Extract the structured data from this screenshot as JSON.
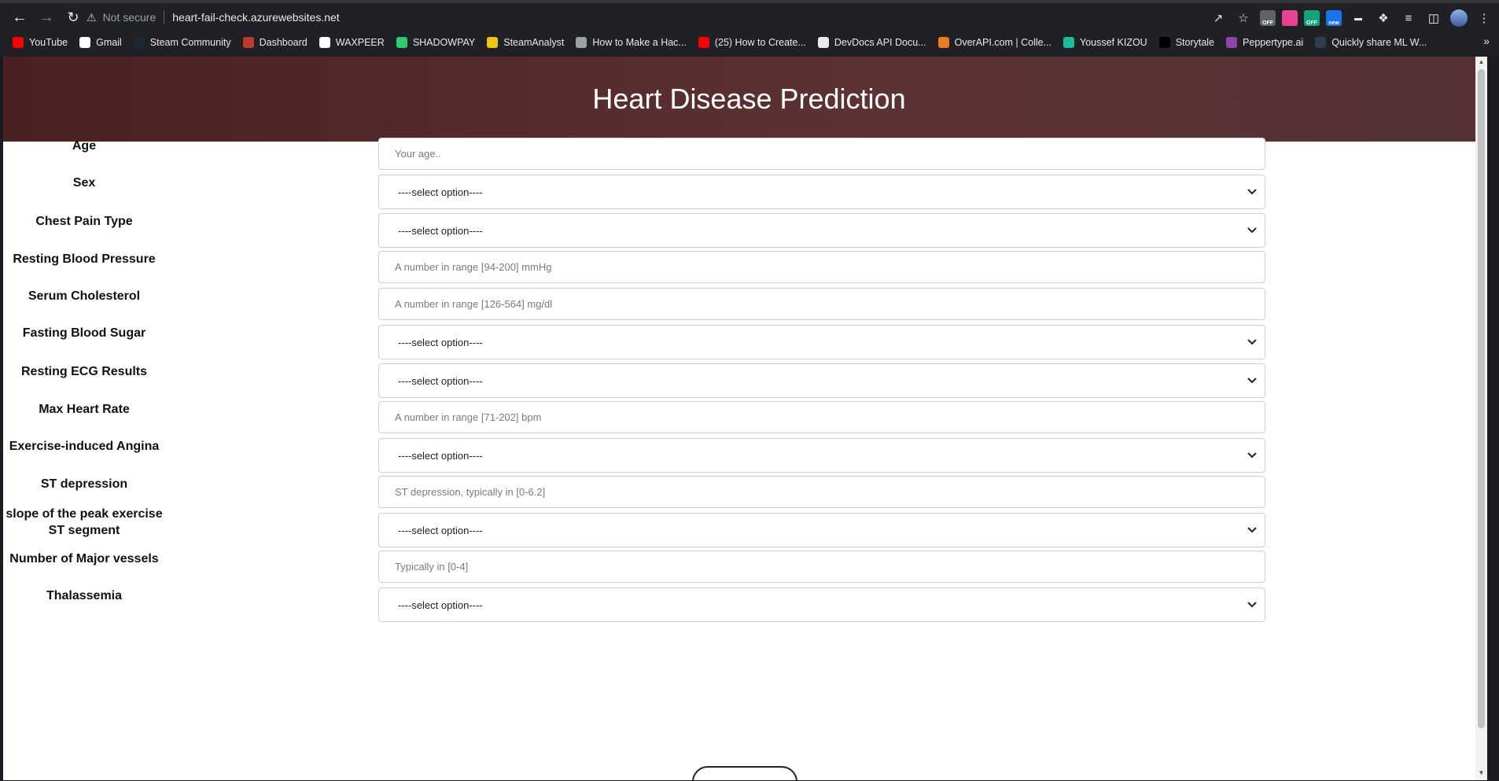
{
  "browser": {
    "not_secure": "Not secure",
    "url": "heart-fail-check.azurewebsites.net",
    "bookmarks": [
      {
        "label": "YouTube",
        "color": "#ff0000",
        "icon": "youtube-icon"
      },
      {
        "label": "Gmail",
        "color": "#ffffff",
        "icon": "google-icon"
      },
      {
        "label": "Steam Community",
        "color": "#1b2838",
        "icon": "steam-icon"
      },
      {
        "label": "Dashboard",
        "color": "#c0392b",
        "icon": "dashboard-icon"
      },
      {
        "label": "WAXPEER",
        "color": "#ffffff",
        "icon": "waxpeer-icon"
      },
      {
        "label": "SHADOWPAY",
        "color": "#2ecc71",
        "icon": "shadowpay-icon"
      },
      {
        "label": "SteamAnalyst",
        "color": "#f1c40f",
        "icon": "steamanalyst-icon"
      },
      {
        "label": "How to Make a Hac...",
        "color": "#9aa0a6",
        "icon": "globe-icon"
      },
      {
        "label": "(25) How to Create...",
        "color": "#ff0000",
        "icon": "youtube-icon"
      },
      {
        "label": "DevDocs API Docu...",
        "color": "#e8eaed",
        "icon": "devdocs-icon"
      },
      {
        "label": "OverAPI.com | Colle...",
        "color": "#e67e22",
        "icon": "overapi-icon"
      },
      {
        "label": "Youssef KIZOU",
        "color": "#1abc9c",
        "icon": "yk-icon"
      },
      {
        "label": "Storytale",
        "color": "#000000",
        "icon": "storytale-icon"
      },
      {
        "label": "Peppertype.ai",
        "color": "#8e44ad",
        "icon": "peppertype-icon"
      },
      {
        "label": "Quickly share ML W...",
        "color": "#2c3e50",
        "icon": "share-icon"
      }
    ],
    "extensions": [
      {
        "name": "off-extension-icon",
        "text": "OFF",
        "color": "#5f6368"
      },
      {
        "name": "color-extension-icon",
        "text": "",
        "color": "#e84393"
      },
      {
        "name": "grammarly-extension-icon",
        "text": "OFF",
        "color": "#15a37f"
      },
      {
        "name": "new-extension-icon",
        "text": "new",
        "color": "#1a73e8"
      }
    ]
  },
  "page": {
    "title": "Heart Disease Prediction",
    "submit_label": "",
    "fields": [
      {
        "label": "Age",
        "type": "input",
        "placeholder": "Your age.."
      },
      {
        "label": "Sex",
        "type": "select",
        "value": "----select option----"
      },
      {
        "label": "Chest Pain Type",
        "type": "select",
        "value": "----select option----"
      },
      {
        "label": "Resting Blood Pressure",
        "type": "input",
        "placeholder": "A number in range [94-200] mmHg"
      },
      {
        "label": "Serum Cholesterol",
        "type": "input",
        "placeholder": "A number in range [126-564] mg/dl"
      },
      {
        "label": "Fasting Blood Sugar",
        "type": "select",
        "value": "----select option----"
      },
      {
        "label": "Resting ECG Results",
        "type": "select",
        "value": "----select option----"
      },
      {
        "label": "Max Heart Rate",
        "type": "input",
        "placeholder": "A number in range [71-202] bpm"
      },
      {
        "label": "Exercise-induced Angina",
        "type": "select",
        "value": "----select option----"
      },
      {
        "label": "ST depression",
        "type": "input",
        "placeholder": "ST depression, typically in [0-6.2]"
      },
      {
        "label": "slope of the peak exercise ST segment",
        "type": "select",
        "value": "----select option----"
      },
      {
        "label": "Number of Major vessels",
        "type": "input",
        "placeholder": "Typically in [0-4]"
      },
      {
        "label": "Thalassemia",
        "type": "select",
        "value": "----select option----"
      }
    ]
  }
}
